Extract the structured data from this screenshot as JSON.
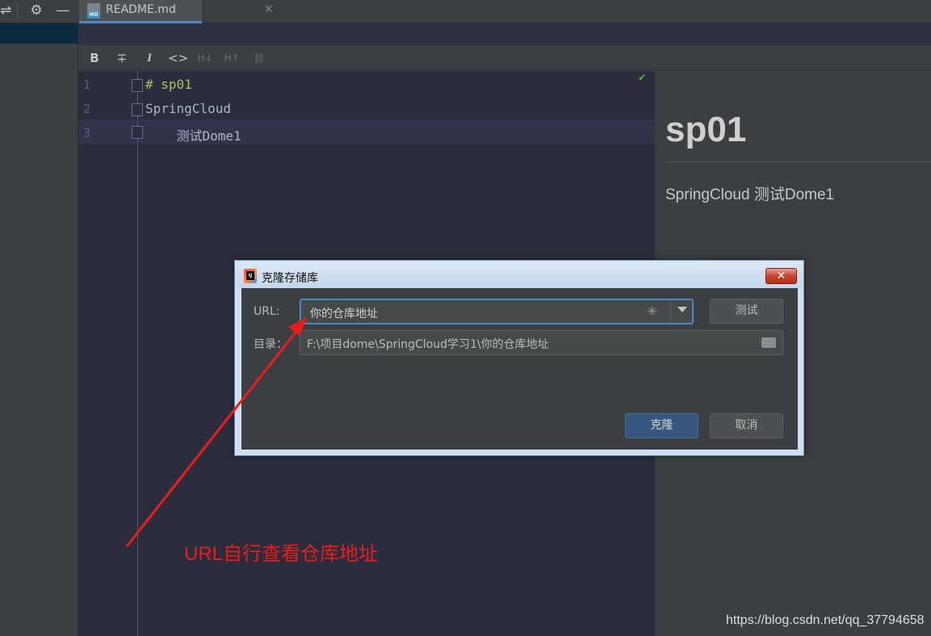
{
  "toolbar": {
    "tab_title": "README.md",
    "tab_close": "×",
    "md_icon_text": "MD"
  },
  "md_toolbar": {
    "bold": "B",
    "strike": "∓",
    "italic": "I",
    "code": "<>",
    "h_down": "H↓",
    "h_up": "H↑"
  },
  "editor": {
    "lines": [
      {
        "num": "1",
        "text": "# sp01",
        "color": "#a5c261"
      },
      {
        "num": "2",
        "text": "SpringCloud",
        "color": "#a9b7c6"
      },
      {
        "num": "3",
        "text": "    测试Dome1",
        "color": "#a9b7c6"
      }
    ]
  },
  "preview": {
    "heading": "sp01",
    "paragraph": "SpringCloud 测试Dome1"
  },
  "dialog": {
    "title": "克隆存储库",
    "url_label": "URL:",
    "url_value": "你的仓库地址",
    "test_button": "测试",
    "dir_label": "目录：",
    "dir_value": "F:\\项目dome\\SpringCloud学习1\\你的仓库地址",
    "clone_button": "克隆",
    "cancel_button": "取消",
    "close_glyph": "✕"
  },
  "annotation": {
    "text": "URL自行查看仓库地址",
    "color": "#ee1b1b"
  },
  "watermark": "https://blog.csdn.net/qq_37794658",
  "colors": {
    "accent": "#4a88c7",
    "primary_button": "#365880"
  }
}
